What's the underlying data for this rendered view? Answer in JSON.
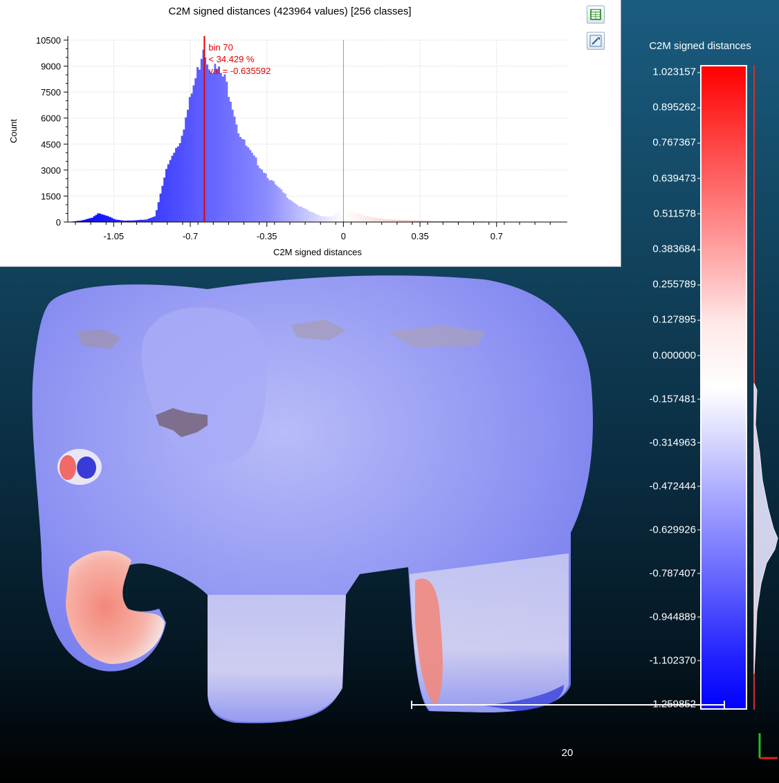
{
  "histogram": {
    "title": "C2M signed distances (423964 values)  [256 classes]",
    "csv_icon": "csv-export-icon",
    "export_icon": "export-image-icon",
    "chart_data": {
      "type": "bar",
      "title": "C2M signed distances (423964 values)  [256 classes]",
      "xlabel": "C2M signed distances",
      "ylabel": "Count",
      "xlim": [
        -1.259852,
        1.023157
      ],
      "ylim": [
        0,
        10500
      ],
      "x_ticks": [
        "-1.05",
        "-0.7",
        "-0.35",
        "0",
        "0.35",
        "0.7"
      ],
      "x_tick_values": [
        -1.05,
        -0.7,
        -0.35,
        0,
        0.35,
        0.7
      ],
      "y_ticks": [
        "0",
        "1500",
        "3000",
        "4500",
        "6000",
        "7500",
        "9000",
        "10500"
      ],
      "y_tick_values": [
        0,
        1500,
        3000,
        4500,
        6000,
        7500,
        9000,
        10500
      ],
      "grid": true,
      "profile": {
        "x": [
          -1.26,
          -1.2,
          -1.15,
          -1.12,
          -1.08,
          -1.04,
          -1.0,
          -0.95,
          -0.9,
          -0.86,
          -0.84,
          -0.81,
          -0.78,
          -0.75,
          -0.72,
          -0.69,
          -0.66,
          -0.64,
          -0.62,
          -0.6,
          -0.57,
          -0.54,
          -0.51,
          -0.48,
          -0.45,
          -0.42,
          -0.39,
          -0.36,
          -0.33,
          -0.3,
          -0.25,
          -0.2,
          -0.15,
          -0.1,
          -0.05,
          0.0,
          0.05,
          0.1,
          0.15,
          0.2,
          0.3,
          0.4,
          0.5,
          0.7,
          1.02
        ],
        "y": [
          0,
          80,
          250,
          500,
          350,
          150,
          80,
          100,
          150,
          350,
          1400,
          3000,
          4000,
          4600,
          6000,
          7600,
          9000,
          10300,
          9200,
          9000,
          8700,
          8200,
          7000,
          5300,
          4500,
          3900,
          3400,
          2900,
          2400,
          2000,
          1400,
          900,
          600,
          350,
          300,
          800,
          600,
          350,
          250,
          150,
          100,
          60,
          40,
          20,
          0
        ]
      },
      "cursor": {
        "x": -0.635592,
        "bin": "bin 70",
        "pct": "< 34.429 %",
        "val": "val = -0.635592"
      }
    }
  },
  "color_scale": {
    "title": "C2M signed distances",
    "labels": [
      "1.023157",
      "0.895262",
      "0.767367",
      "0.639473",
      "0.511578",
      "0.383684",
      "0.255789",
      "0.127895",
      "0.000000",
      "-0.157481",
      "-0.314963",
      "-0.472444",
      "-0.629926",
      "-0.787407",
      "-0.944889",
      "-1.102370",
      "-1.259852"
    ],
    "values": [
      1.023157,
      0.895262,
      0.767367,
      0.639473,
      0.511578,
      0.383684,
      0.255789,
      0.127895,
      0.0,
      -0.157481,
      -0.314963,
      -0.472444,
      -0.629926,
      -0.787407,
      -0.944889,
      -1.10237,
      -1.259852
    ]
  },
  "scale_ruler": {
    "label": "20"
  },
  "colors": {
    "positive": "#ff0000",
    "zero": "#ffffff",
    "negative": "#0000ff",
    "cursor": "#e00000"
  }
}
